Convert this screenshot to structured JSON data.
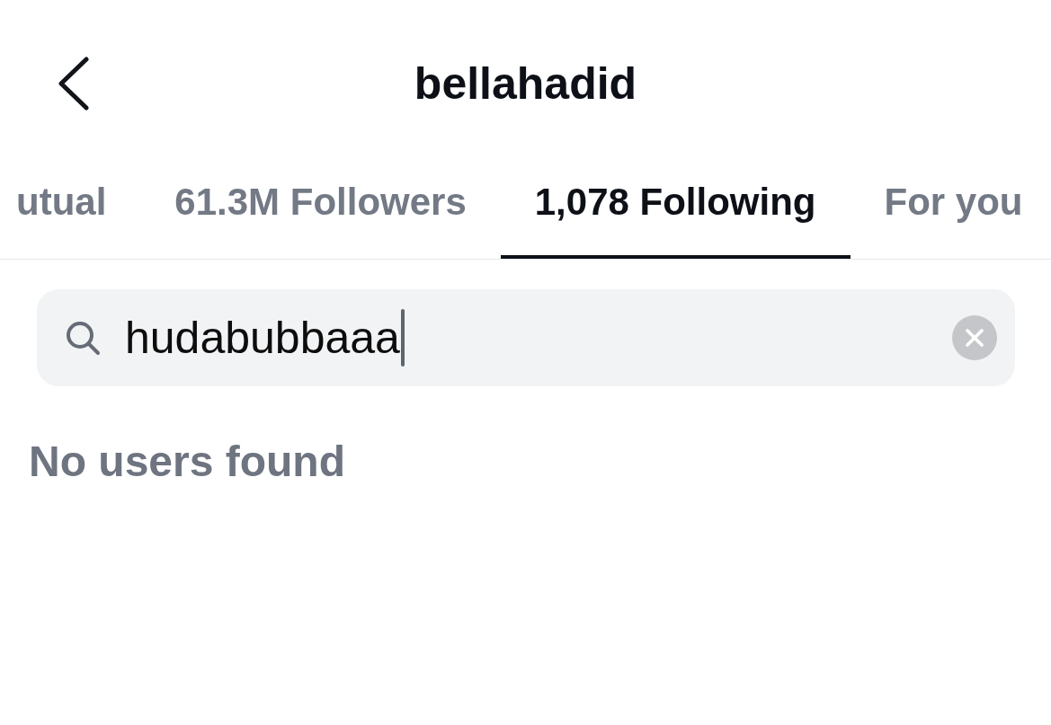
{
  "header": {
    "title": "bellahadid"
  },
  "tabs": [
    {
      "label": "utual",
      "selected": false
    },
    {
      "label": "61.3M Followers",
      "selected": false
    },
    {
      "label": "1,078 Following",
      "selected": true
    },
    {
      "label": "For you",
      "selected": false
    }
  ],
  "search": {
    "value": "hudabubbaaa",
    "focused": true
  },
  "results": {
    "message": "No users found"
  }
}
